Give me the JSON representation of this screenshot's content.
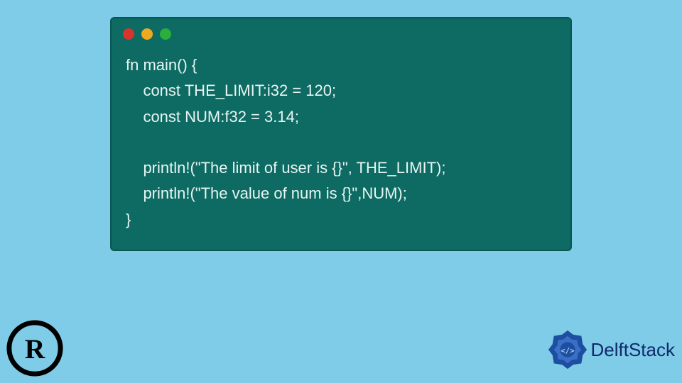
{
  "code": {
    "lines": [
      "fn main() {",
      "    const THE_LIMIT:i32 = 120;",
      "    const NUM:f32 = 3.14;",
      "",
      "    println!(\"The limit of user is {}\", THE_LIMIT);",
      "    println!(\"The value of num is {}\",NUM);",
      "}"
    ]
  },
  "brand": {
    "name": "DelftStack"
  }
}
